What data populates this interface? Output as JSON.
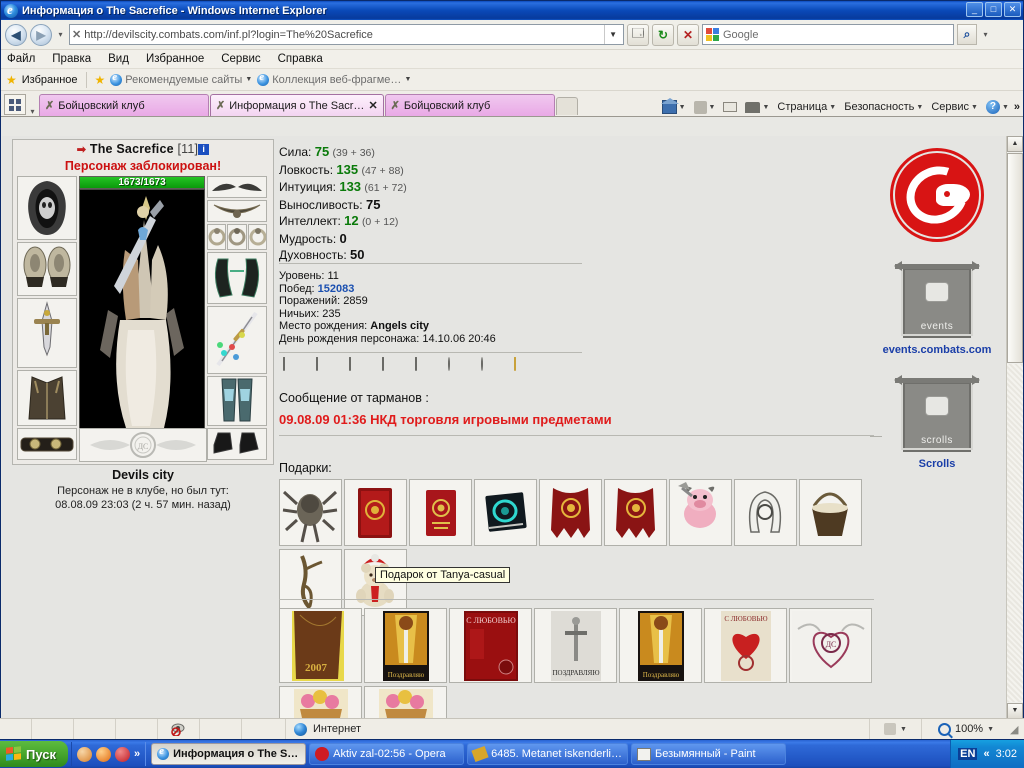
{
  "window": {
    "title": "Информация о The Sacrefice - Windows Internet Explorer",
    "minimize": "_",
    "maximize": "□",
    "close": "✕"
  },
  "address": {
    "url": "http://devilscity.combats.com/inf.pl?login=The%20Sacrefice",
    "dropdown": "▼"
  },
  "search": {
    "placeholder": "Google",
    "value": "Google",
    "go": "⌕"
  },
  "menu": [
    "Файл",
    "Правка",
    "Вид",
    "Избранное",
    "Сервис",
    "Справка"
  ],
  "favbar": {
    "favorites": "Избранное",
    "items": [
      "Рекомендуемые сайты",
      "Коллекция веб-фрагме…"
    ]
  },
  "tabs": [
    {
      "label": "Бойцовский клуб",
      "active": false,
      "closable": false
    },
    {
      "label": "Информация о The Sacr…",
      "active": true,
      "closable": true
    },
    {
      "label": "Бойцовский клуб",
      "active": false,
      "closable": false
    }
  ],
  "commandbar": [
    "Страница",
    "Безопасность",
    "Сервис"
  ],
  "character": {
    "name": "The Sacrefice",
    "level_bracket": "[11]",
    "info_badge": "i",
    "blocked_notice": "Персонаж заблокирован!",
    "hp": "1673/1673",
    "club_name": "Devils city",
    "club_status_line1": "Персонаж не в клубе, но был тут:",
    "club_status_line2": "08.08.09 23:03 (2 ч. 57 мин. назад)"
  },
  "stats": [
    {
      "label": "Сила:",
      "value": "75",
      "detail": "(39 + 36)",
      "green": true
    },
    {
      "label": "Ловкость:",
      "value": "135",
      "detail": "(47 + 88)",
      "green": true
    },
    {
      "label": "Интуиция:",
      "value": "133",
      "detail": "(61 + 72)",
      "green": true
    },
    {
      "label": "Выносливость:",
      "value": "75",
      "detail": "",
      "green": false
    },
    {
      "label": "Интеллект:",
      "value": "12",
      "detail": "(0 + 12)",
      "green": true
    },
    {
      "label": "Мудрость:",
      "value": "0",
      "detail": "",
      "green": false
    },
    {
      "label": "Духовность:",
      "value": "50",
      "detail": "",
      "green": false
    }
  ],
  "info": {
    "level": "Уровень: 11",
    "wins_label": "Побед:",
    "wins_value": "152083",
    "losses": "Поражений: 2859",
    "draws": "Ничьих: 235",
    "birthplace_label": "Место рождения:",
    "birthplace_value": "Angels city",
    "birthday": "День рождения персонажа: 14.10.06 20:46"
  },
  "medals": [
    {
      "name": "medal-blue",
      "color": "#5a6ea8"
    },
    {
      "name": "medal-silver",
      "color": "#c7c7c2"
    },
    {
      "name": "medal-red",
      "color": "#b01f1f"
    },
    {
      "name": "medal-green",
      "color": "#8fd1b0"
    },
    {
      "name": "medal-bronze",
      "color": "#a8702c"
    },
    {
      "name": "medal-crimson",
      "color": "#cc1a1a"
    },
    {
      "name": "medal-grey",
      "color": "#8f8f8a"
    },
    {
      "name": "medal-purple",
      "color": "#7b4fbd"
    }
  ],
  "message": {
    "from": "Сообщение от тарманов :",
    "text": "09.08.09 01:36 НКД торговля игровыми предметами"
  },
  "gifts": {
    "title": "Подарки:",
    "row1": [
      "spider-gift",
      "red-book-gift",
      "red-passport-gift",
      "dark-book-gift",
      "red-cloak-gift",
      "red-cloak-gift-2",
      "pig-gift",
      "horseshoe-gift",
      "basket-gift"
    ],
    "row2": [
      "branch-gift",
      "teddy-bear-gift"
    ],
    "tooltip": "Подарок от Tanya-casual"
  },
  "items": {
    "row1": [
      "card-2007",
      "card-congrats",
      "card-with-love",
      "card-sword-grey",
      "card-congrats-2",
      "card-heart",
      "card-emblem-heart"
    ],
    "row2": [
      "card-flowers",
      "card-flowers-2"
    ]
  },
  "ads": {
    "logo": "combats-logo",
    "events_label": "events.combats.com",
    "events_banner_word": "events",
    "scrolls_label": "Scrolls",
    "scrolls_banner_word": "scrolls"
  },
  "statusbar": {
    "zone": "Интернет",
    "zoom": "100%"
  },
  "taskbar": {
    "start": "Пуск",
    "tasks": [
      {
        "label": "Информация о The S…",
        "active": true,
        "icon": "ie-icon"
      },
      {
        "label": "Aktiv zal-02:56 - Opera",
        "active": false,
        "icon": "opera-icon"
      },
      {
        "label": "6485. Metanet iskenderli…",
        "active": false,
        "icon": "pencil-icon"
      },
      {
        "label": "Безымянный - Paint",
        "active": false,
        "icon": "paint-icon"
      }
    ],
    "lang": "EN",
    "clock": "3:02"
  }
}
